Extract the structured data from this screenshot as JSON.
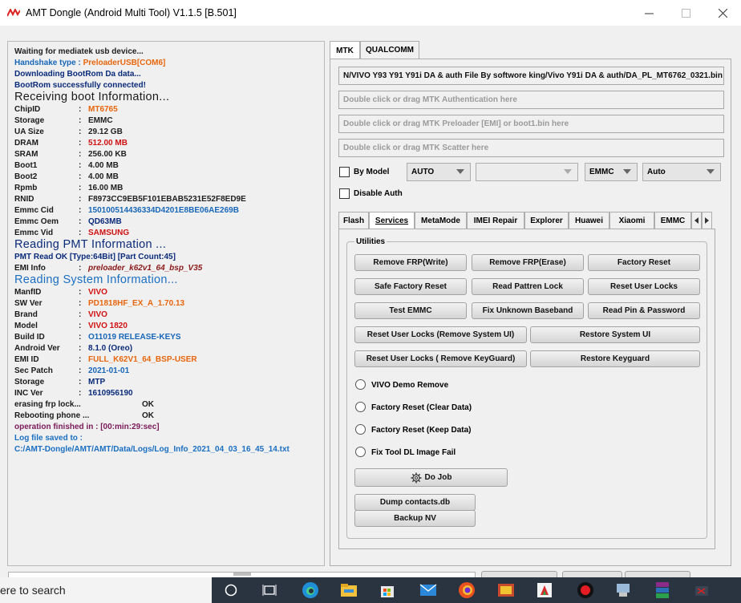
{
  "window": {
    "title": "AMT Dongle (Android Multi Tool) V1.1.5 [B.501]"
  },
  "log": {
    "lines": [
      "Waiting for mediatek usb device...",
      "Handshake type :",
      "PreloaderUSB[COM6]",
      "Downloading BootRom Da data...",
      "BootRom successfully connected!",
      "Receiving boot Information...",
      "Reading PMT Information ...",
      "PMT Read OK [Type:64Bit] [Part Count:45]",
      "Reading System Information...",
      "erasing frp lock...",
      "OK",
      "Rebooting phone ...",
      "OK",
      "operation finished in : [00:min:29:sec]",
      "Log file saved to :",
      "C:/AMT-Dongle/AMT/AMT/Data/Logs/Log_Info_2021_04_03_16_45_14.txt"
    ],
    "boot_info": [
      {
        "k": "ChipID",
        "v": "MT6765"
      },
      {
        "k": "Storage",
        "v": "EMMC"
      },
      {
        "k": "UA Size",
        "v": "29.12 GB"
      },
      {
        "k": "DRAM",
        "v": "512.00 MB"
      },
      {
        "k": "SRAM",
        "v": "256.00 KB"
      },
      {
        "k": "Boot1",
        "v": "4.00 MB"
      },
      {
        "k": "Boot2",
        "v": "4.00 MB"
      },
      {
        "k": "Rpmb",
        "v": "16.00 MB"
      },
      {
        "k": "RNID",
        "v": "F8973CC9EB5F101EBAB5231E52F8ED9E"
      },
      {
        "k": "Emmc Cid",
        "v": "150100514436334D4201E8BE06AE269B"
      },
      {
        "k": "Emmc Oem",
        "v": "QD63MB"
      },
      {
        "k": "Emmc Vid",
        "v": "SAMSUNG"
      }
    ],
    "emi": {
      "k": "EMI Info",
      "v": "preloader_k62v1_64_bsp_V35"
    },
    "sys_info": [
      {
        "k": "ManfID",
        "v": "VIVO"
      },
      {
        "k": "SW Ver",
        "v": "PD1818HF_EX_A_1.70.13"
      },
      {
        "k": "Brand",
        "v": "VIVO"
      },
      {
        "k": "Model",
        "v": "VIVO 1820"
      },
      {
        "k": "Build ID",
        "v": "O11019 RELEASE-KEYS"
      },
      {
        "k": "Android Ver",
        "v": "8.1.0 (Oreo)"
      },
      {
        "k": "EMI ID",
        "v": "FULL_K62V1_64_BSP-USER"
      },
      {
        "k": "Sec Patch",
        "v": "2021-01-01"
      },
      {
        "k": "Storage",
        "v": "MTP"
      },
      {
        "k": "INC Ver",
        "v": "1610956190"
      }
    ],
    "sep": ":"
  },
  "tabs": {
    "mtk": "MTK",
    "qualcomm": "QUALCOMM"
  },
  "fields": {
    "da_file": "N/VIVO Y93 Y91 Y91i DA & auth File By softwore king/Vivo Y91i DA & auth/DA_PL_MT6762_0321.bin",
    "auth_placeholder": "Double click or drag MTK Authentication here",
    "preloader_placeholder": "Double click or drag MTK Preloader [EMI] or boot1.bin here",
    "scatter_placeholder": "Double click or drag MTK Scatter here"
  },
  "options": {
    "by_model": "By Model",
    "model_select": "AUTO",
    "model_blank": "",
    "storage_select": "EMMC",
    "mode_select": "Auto",
    "disable_auth": "Disable Auth"
  },
  "subtabs": [
    "Flash",
    "Services",
    "MetaMode",
    "IMEI Repair",
    "Explorer",
    "Huawei",
    "Xiaomi",
    "EMMC"
  ],
  "utilities": {
    "title": "Utilities",
    "buttons": [
      "Remove FRP(Write)",
      "Remove FRP(Erase)",
      "Factory Reset",
      "Safe Factory Reset",
      "Read Pattren Lock",
      "Reset User Locks",
      "Test EMMC",
      "Fix Unknown Baseband",
      "Read Pin & Password",
      "Reset User Locks (Remove System UI)",
      "Restore System UI",
      "Reset User Locks ( Remove KeyGuard)",
      "Restore Keyguard"
    ],
    "radios": [
      "VIVO Demo Remove",
      "Factory Reset (Clear Data)",
      "Factory Reset (Keep Data)",
      "Fix Tool DL Image Fail"
    ],
    "do_job": "Do Job",
    "dump_contacts": "Dump contacts.db",
    "backup_nv": "Backup NV"
  },
  "taskbar": {
    "search_text": "ere to search"
  }
}
